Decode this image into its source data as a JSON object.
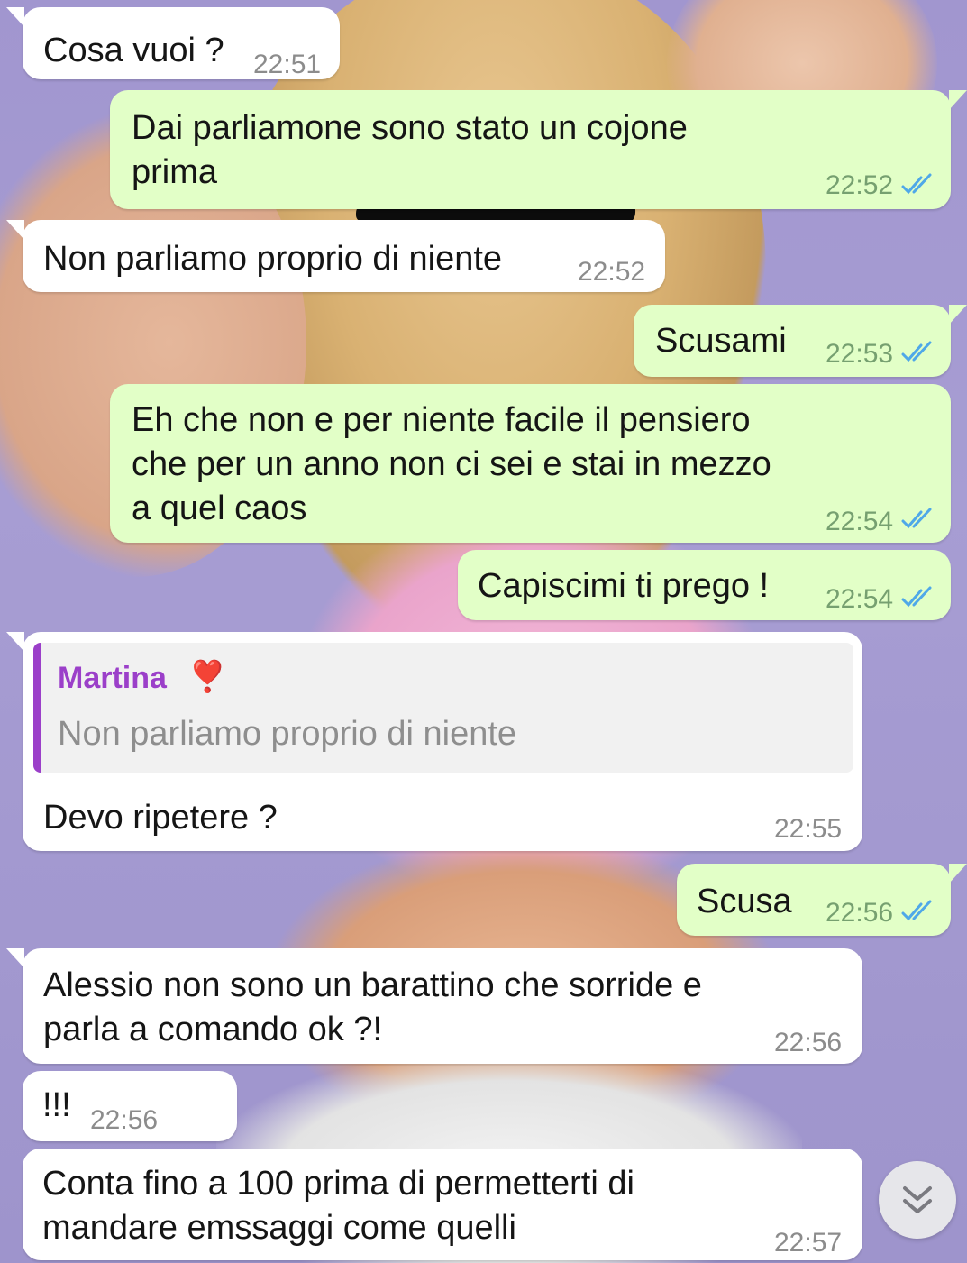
{
  "messages": [
    {
      "text": "Cosa vuoi ?",
      "time": "22:51"
    },
    {
      "text": "Dai parliamone sono stato un cojone\nprima",
      "time": "22:52"
    },
    {
      "text": "Non parliamo proprio di niente",
      "time": "22:52"
    },
    {
      "text": "Scusami",
      "time": "22:53"
    },
    {
      "text": "Eh che non e per niente facile il pensiero\nche per un anno non ci sei e stai in mezzo\na quel caos",
      "time": "22:54"
    },
    {
      "text": "Capiscimi ti prego !",
      "time": "22:54"
    },
    {
      "text": "Devo ripetere ?",
      "time": "22:55",
      "quote": {
        "author": "Martina",
        "author_emoji": "❣️",
        "text": "Non parliamo proprio di niente"
      }
    },
    {
      "text": "Scusa",
      "time": "22:56"
    },
    {
      "text": "Alessio non sono un barattino che sorride e\nparla a comando ok ?!",
      "time": "22:56"
    },
    {
      "text": "!!!",
      "time": "22:56"
    },
    {
      "text": "Conta fino a 100 prima di permetterti di\nmandare emssaggi come quelli",
      "time": "22:57"
    }
  ],
  "colors": {
    "incoming_bubble": "#ffffff",
    "outgoing_bubble": "#e2ffc7",
    "read_ticks": "#4fa8e8",
    "quote_accent": "#9b3fc9"
  },
  "icons": {
    "read_receipt": "double-check-icon",
    "scroll_down": "chevron-double-down-icon"
  }
}
